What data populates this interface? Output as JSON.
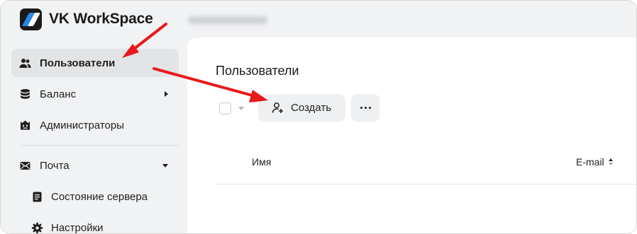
{
  "app": {
    "brand": "VK WorkSpace"
  },
  "sidebar": {
    "items": [
      {
        "label": "Пользователи",
        "icon": "users-icon",
        "active": true
      },
      {
        "label": "Баланс",
        "icon": "coins-icon",
        "arrow": "right"
      },
      {
        "label": "Администраторы",
        "icon": "admin-icon"
      },
      {
        "label": "Почта",
        "icon": "mail-icon",
        "arrow": "down"
      }
    ],
    "subitems": [
      {
        "label": "Состояние сервера",
        "icon": "document-icon"
      },
      {
        "label": "Настройки",
        "icon": "gear-icon"
      }
    ]
  },
  "main": {
    "title": "Пользователи",
    "toolbar": {
      "create_label": "Создать",
      "create_icon": "add-user-icon",
      "more_icon": "more-dots-icon"
    },
    "table": {
      "columns": [
        "Имя",
        "E-mail"
      ]
    }
  },
  "colors": {
    "accent": "#2688eb",
    "annotation_arrow": "#e8191b",
    "sidebar_bg": "#f1f2f4",
    "active_item_bg": "#e3e4e6"
  }
}
